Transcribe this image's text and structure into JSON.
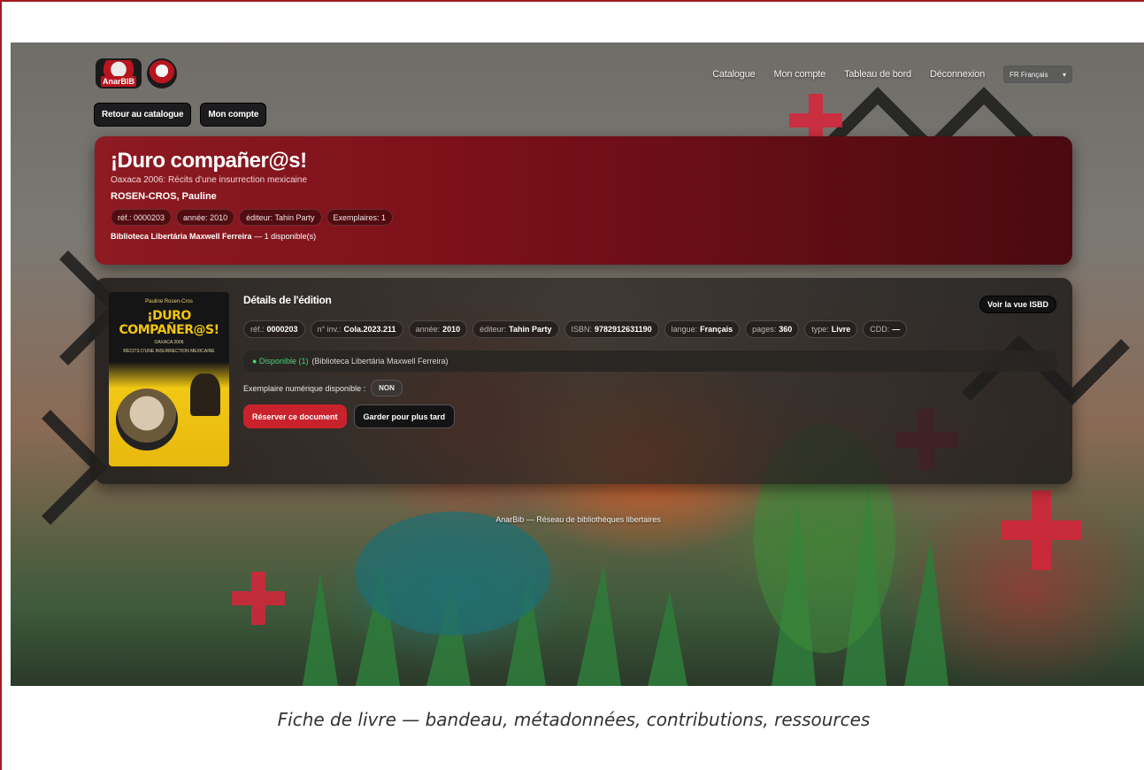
{
  "navbar": {
    "logo_tag": "AnarBIB",
    "links": [
      "Catalogue",
      "Mon compte",
      "Tableau de bord",
      "Déconnexion"
    ],
    "language": "FR Français"
  },
  "subnav": {
    "back_label": "Retour au catalogue",
    "account_label": "Mon compte"
  },
  "hero": {
    "title": "¡Duro compañer@s!",
    "subtitle": "Oaxaca 2006: Récits d'une insurrection mexicaine",
    "author": "ROSEN-CROS, Pauline",
    "pills": [
      "réf.: 0000203",
      "année: 2010",
      "éditeur: Tahin Party",
      "Exemplaires: 1"
    ],
    "library_name": "Biblioteca Libertária Maxwell Ferreira",
    "library_availability": "— 1 disponible(s)"
  },
  "cover": {
    "author": "Pauline Rosen-Cros",
    "title": "¡DURO COMPAÑER@S!",
    "subtitle_line1": "OAXACA 2006",
    "subtitle_line2": "RÉCITS D'UNE INSURRECTION MEXICAINE"
  },
  "details": {
    "heading": "Détails de l'édition",
    "isbd_label": "Voir la vue ISBD",
    "meta": [
      {
        "label": "réf.:",
        "value": "0000203"
      },
      {
        "label": "n° inv.:",
        "value": "Cola.2023.211"
      },
      {
        "label": "année:",
        "value": "2010"
      },
      {
        "label": "éditeur:",
        "value": "Tahin Party"
      },
      {
        "label": "ISBN:",
        "value": "9782912631190"
      },
      {
        "label": "langue:",
        "value": "Français"
      },
      {
        "label": "pages:",
        "value": "360"
      },
      {
        "label": "type:",
        "value": "Livre"
      },
      {
        "label": "CDD:",
        "value": "—"
      }
    ],
    "availability_status": "● Disponible (1)",
    "availability_library": "(Biblioteca Libertária Maxwell Ferreira)",
    "digital_label": "Exemplaire numérique disponible :",
    "digital_value": "NON",
    "reserve_label": "Réserver ce document",
    "later_label": "Garder pour plus tard"
  },
  "footer": {
    "text": "AnarBib — Réseau de bibliothèques libertaires"
  },
  "caption": "Fiche de livre — bandeau, métadonnées, contributions, ressources",
  "colors": {
    "accent": "#c9222c",
    "hero_bg": "#7a1019",
    "available": "#4fd37a"
  }
}
